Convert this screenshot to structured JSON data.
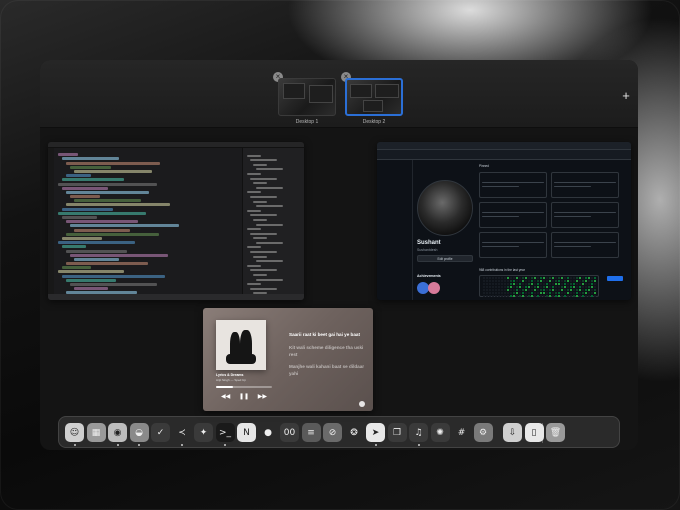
{
  "mission_control": {
    "spaces": [
      {
        "label": "Desktop 1",
        "selected": false
      },
      {
        "label": "Desktop 2",
        "selected": true
      }
    ],
    "add_space_symbol": "+",
    "close_symbol": "×"
  },
  "windows": {
    "code_editor": {
      "app": "code-editor"
    },
    "browser": {
      "app": "browser",
      "profile_name": "Sushant",
      "profile_username": "Sushantdesh",
      "edit_profile_label": "Edit profile",
      "achievements_label": "Achievements",
      "contributions_label": "968 contributions in the last year",
      "section_title": "Pinned"
    },
    "music": {
      "song_title": "Lyrics & Dreams",
      "artist": "Arjit Singh — Sped Up",
      "progress": 0.3,
      "lyrics": [
        {
          "text": "Saarii raat ki beet gai hai ye baat",
          "active": true
        },
        {
          "text": "Kit wali scheme diligence tha uski rest",
          "active": false
        },
        {
          "text": "Manjhe wali kahani baat se dildaar yahi",
          "active": false
        }
      ]
    }
  },
  "dock": {
    "apps": [
      {
        "name": "finder-icon",
        "glyph": "☺",
        "color": "#d0d0d0",
        "running": true
      },
      {
        "name": "launchpad-icon",
        "glyph": "▦",
        "color": "#9a9a9a",
        "running": false
      },
      {
        "name": "chatgpt-icon",
        "glyph": "◉",
        "color": "#bdbdbd",
        "running": true
      },
      {
        "name": "arc-icon",
        "glyph": "◒",
        "color": "#8a8a8a",
        "running": true
      },
      {
        "name": "reminders-icon",
        "glyph": "✓",
        "color": "#3a3a3a",
        "running": false
      },
      {
        "name": "vscode-icon",
        "glyph": "≺",
        "color": "#2a2a2a",
        "running": true
      },
      {
        "name": "perplexity-icon",
        "glyph": "✦",
        "color": "#3a3a3a",
        "running": false
      },
      {
        "name": "terminal-icon",
        "glyph": ">_",
        "color": "#1a1a1a",
        "running": true
      },
      {
        "name": "notion-icon",
        "glyph": "N",
        "color": "#e6e6e6",
        "running": false
      },
      {
        "name": "camera-icon",
        "glyph": "●",
        "color": "#2a2a2a",
        "running": false
      },
      {
        "name": "screen-mirror-icon",
        "glyph": "00",
        "color": "#3a3a3a",
        "running": false
      },
      {
        "name": "menubar-icon",
        "glyph": "≡",
        "color": "#5a5a5a",
        "running": false
      },
      {
        "name": "safari-icon",
        "glyph": "⊘",
        "color": "#6a6a6a",
        "running": false
      },
      {
        "name": "openai-icon",
        "glyph": "❂",
        "color": "#2a2a2a",
        "running": false
      },
      {
        "name": "telegram-icon",
        "glyph": "➤",
        "color": "#e8e8e8",
        "running": true
      },
      {
        "name": "files-icon",
        "glyph": "❐",
        "color": "#3a3a3a",
        "running": false
      },
      {
        "name": "music-icon",
        "glyph": "♫",
        "color": "#3a3a3a",
        "running": true
      },
      {
        "name": "photos-icon",
        "glyph": "✺",
        "color": "#3a3a3a",
        "running": false
      },
      {
        "name": "slack-icon",
        "glyph": "#",
        "color": "#2a2a2a",
        "running": false
      },
      {
        "name": "system-settings-icon",
        "glyph": "⚙",
        "color": "#7a7a7a",
        "running": false
      },
      {
        "name": "downloads-icon",
        "glyph": "⇩",
        "color": "#cfcfcf",
        "running": false
      },
      {
        "name": "documents-icon",
        "glyph": "▯",
        "color": "#e8e8e8",
        "running": false
      },
      {
        "name": "trash-icon",
        "glyph": "🗑",
        "color": "#9a9a9a",
        "running": false
      }
    ]
  }
}
